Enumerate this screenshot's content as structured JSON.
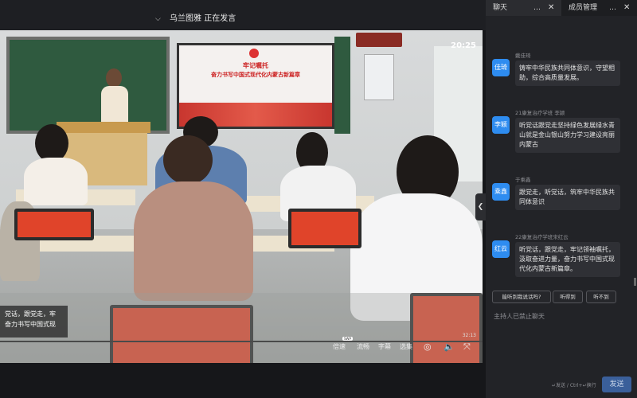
{
  "top_bar": {
    "chevron": "chevron-down-icon",
    "speaker_text": "乌兰图雅 正在发言"
  },
  "video": {
    "timestamp": "20:25",
    "slide_title_1": "牢记嘱托",
    "slide_title_2": "奋力书写中国式现代化内蒙古新篇章",
    "subtitle": "党话，跟党走，牢\n奋力书写中国式现",
    "duration": "32:13"
  },
  "controls": {
    "speed": "倍速",
    "speed_badge": "SWP",
    "quality": "流畅",
    "captions": "字幕",
    "episodes": "选集",
    "icons": [
      "settings-icon",
      "volume-icon",
      "fullscreen-exit-icon"
    ]
  },
  "panel": {
    "tab_chat": "聊天",
    "tab_members": "成员管理",
    "more_icon": "more-icon",
    "close_icon": "close-icon"
  },
  "messages": [
    {
      "avatar": "佳琦",
      "name": "戴佳琦",
      "text": "铸牢中华民族共同体意识，守望相助，综合高质量发展。"
    },
    {
      "avatar": "李颖",
      "name": "21康复治疗学班 李颖",
      "text": "听党话跟党走坚持绿色发展绿水青山就是金山银山努力学习建设亮丽内蒙古"
    },
    {
      "avatar": "乘鑫",
      "name": "于乘鑫",
      "text": "跟党走，听党话，筑牢中华民族共同体意识"
    },
    {
      "avatar": "红云",
      "name": "22康复治疗学班宋红云",
      "text": "听党话，跟党走，牢记领袖嘱托，汲取奋进力量，奋力书写中国式现代化内蒙古新篇章。"
    }
  ],
  "quick_replies": [
    "能听到我说话吗?",
    "听得到",
    "听不到"
  ],
  "chat_disabled": "主持人已禁止聊天",
  "input_hint": "↵发送 / Ctrl+↵换行",
  "send_label": "发送",
  "colors": {
    "accent": "#2e8cf0",
    "panel_bg": "#222327",
    "send_btn": "#3a5f9a"
  }
}
